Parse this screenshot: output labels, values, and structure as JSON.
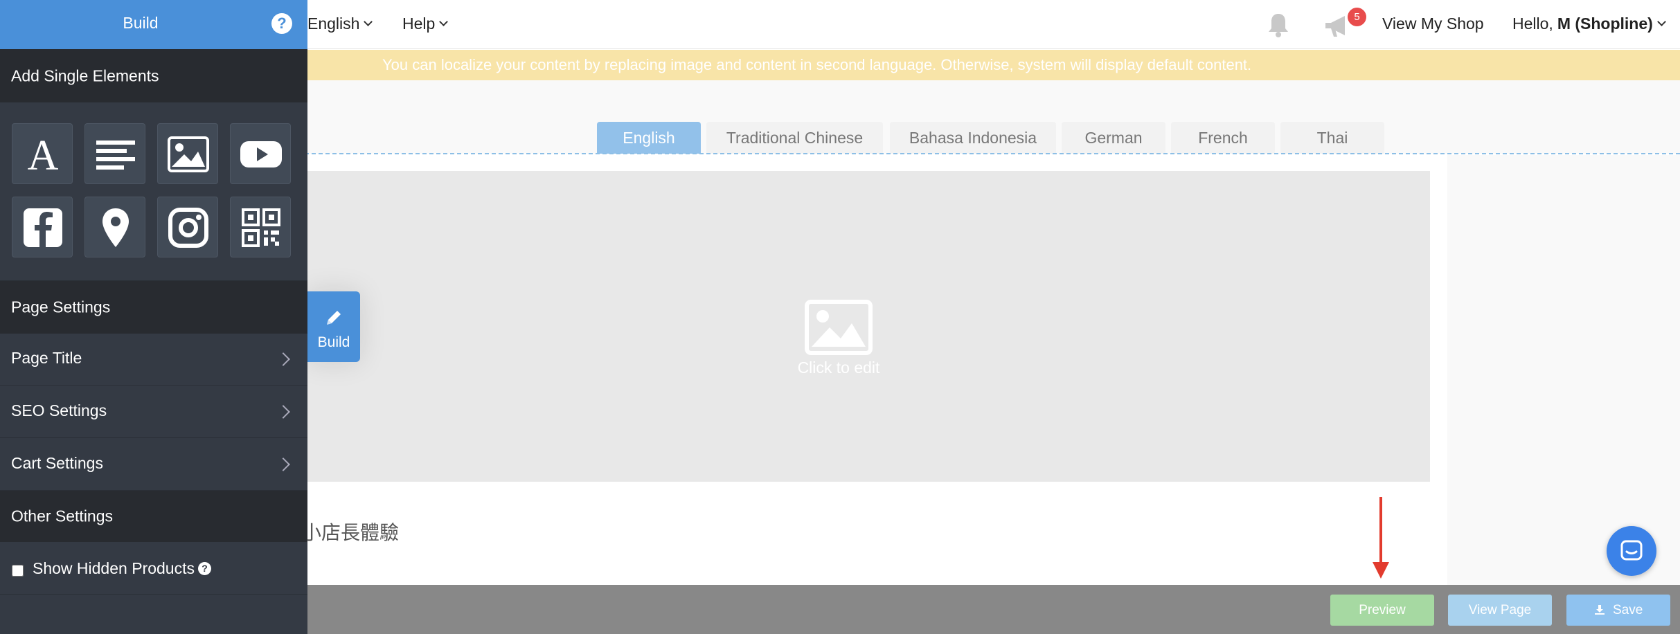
{
  "topbar": {
    "language": "English",
    "help": "Help",
    "notification_count": "5",
    "view_shop": "View My Shop",
    "hello": "Hello,",
    "user": "M (Shopline)"
  },
  "notice": "You can localize your content by replacing image and content in second language. Otherwise, system will display default content.",
  "languages": [
    "English",
    "Traditional Chinese",
    "Bahasa Indonesia",
    "German",
    "French",
    "Thai"
  ],
  "canvas": {
    "click_to_edit": "Click to edit",
    "text_block": "小店長體驗"
  },
  "sidebar": {
    "title": "Build",
    "help_icon": "?",
    "add_elements": "Add Single Elements",
    "tools": [
      "text-icon",
      "paragraph-icon",
      "image-icon",
      "youtube-icon",
      "facebook-icon",
      "map-pin-icon",
      "instagram-icon",
      "qr-code-icon"
    ],
    "page_settings": "Page Settings",
    "items": [
      {
        "label": "Page Title"
      },
      {
        "label": "SEO Settings"
      },
      {
        "label": "Cart Settings"
      }
    ],
    "other_settings": "Other Settings",
    "show_hidden": "Show Hidden Products",
    "show_hidden_checked": false
  },
  "float_build": "Build",
  "bottom": {
    "preview": "Preview",
    "view_page": "View Page",
    "save": "Save"
  },
  "colors": {
    "brand_blue": "#4a90d9",
    "sidebar": "#343a44",
    "notice_bg": "#f8e4a8",
    "badge_red": "#e84c4c",
    "arrow_red": "#e23b2e"
  }
}
